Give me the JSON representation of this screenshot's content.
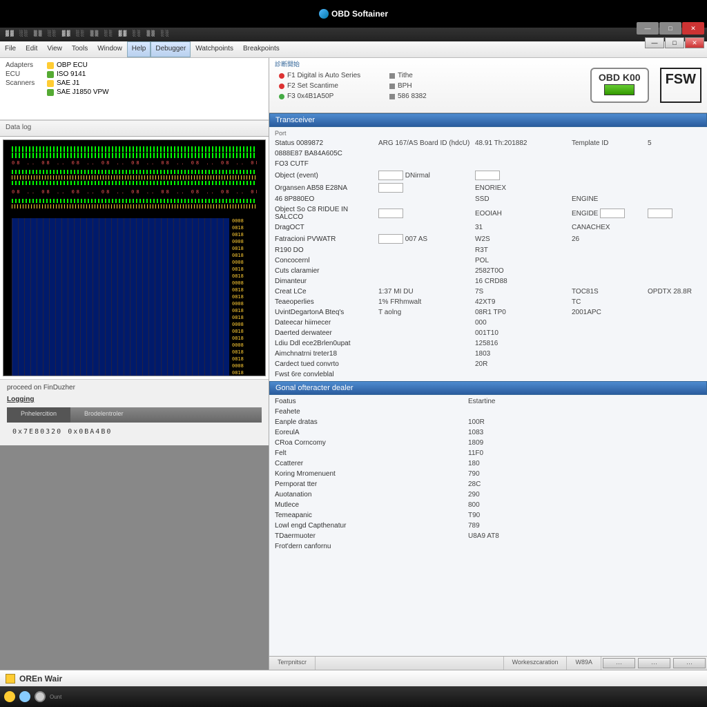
{
  "title": "OBD Softainer",
  "menubar": [
    "File",
    "Edit",
    "View",
    "Tools",
    "Window",
    "Help",
    "Debugger",
    "Watchpoints",
    "Breakpoints"
  ],
  "tree": {
    "left_col": [
      "Adapters",
      "ECU",
      "Scanners"
    ],
    "items": [
      {
        "icon": "yellow",
        "label": "OBP ECU"
      },
      {
        "icon": "green",
        "label": "ISO 9141"
      },
      {
        "icon": "yellow",
        "label": "SAE J1"
      },
      {
        "icon": "green",
        "label": "SAE J1850 VPW"
      }
    ],
    "subtab": "Data log"
  },
  "left_footer": {
    "line1": "proceed on FinDuzher",
    "link": "Logging",
    "crumb": "0x7E80320  0x0BA4B0"
  },
  "band": {
    "tablabel": "診断開始",
    "col1": [
      {
        "icon": "red",
        "label": "F1 Digital is Auto Series"
      },
      {
        "icon": "red",
        "label": "F2 Set Scantime"
      },
      {
        "icon": "grn",
        "label": "F3 0x4B1A50P"
      }
    ],
    "col2": [
      {
        "icon": "gry",
        "label": "Tithe"
      },
      {
        "icon": "gry",
        "label": "BPH"
      },
      {
        "icon": "gry",
        "label": "586 8382"
      }
    ],
    "obd": "OBD K00",
    "logo": "FSW"
  },
  "section1": {
    "title": "Transceiver",
    "sub": "Port",
    "rows": [
      {
        "l": "Status 0089872",
        "v2": "ARG 167/AS Board ID (hdcU)",
        "v3": "48.91 Th:201882",
        "v4": "Template ID",
        "v5": "5"
      },
      {
        "l": "0888E87 BA84A605C",
        "v2": "",
        "v3": "",
        "v4": "",
        "v5": ""
      },
      {
        "l": "FO3 CUTF",
        "v2": "",
        "v3": "",
        "v4": "",
        "v5": ""
      },
      {
        "l": "Object (event)",
        "v2_input": "",
        "v2b": "DNirmal",
        "v3_input": "",
        "v4": "",
        "v5": ""
      },
      {
        "l": "Organsen AB58 E28NA",
        "v2_input": "",
        "v3": "ENORIEX",
        "v4": "",
        "v5": ""
      },
      {
        "l": "46 8P880EO",
        "v2": "",
        "v3": "SSD",
        "v4": "ENGINE",
        "v5": ""
      },
      {
        "l": "Object So C8 RIDUE IN SALCCO",
        "v2_input": "",
        "v3": "EOOIAH",
        "v4": "ENGIDE",
        "v4_input": "",
        "v5_input": ""
      },
      {
        "l": "DragOCT",
        "v2": "",
        "v3": "31",
        "v4": "CANACHEX",
        "v5": ""
      },
      {
        "l": "Fatracioni PVWATR",
        "v2_input": "",
        "v2b": "007 AS",
        "v3": "W2S",
        "v4": "26",
        "v5": ""
      },
      {
        "l": "R190 DO",
        "v2": "",
        "v3": "R3T",
        "v4": "",
        "v5": ""
      },
      {
        "l": "Concocernl",
        "v2": "",
        "v3": "POL",
        "v4": "",
        "v5": ""
      },
      {
        "l": "Cuts claramier",
        "v2": "",
        "v3": "2582T0O",
        "v4": "",
        "v5": ""
      },
      {
        "l": "Dimanteur",
        "v2": "",
        "v3": "16 CRD88",
        "v4": "",
        "v5": ""
      },
      {
        "l": "Creat LCe",
        "v2": "1:37 MI DU",
        "v3": "7S",
        "v4": "TOC81S",
        "v5": "OPDTX 28.8R"
      },
      {
        "l": "Teaeoperlies",
        "v2": "1% FRhmwalt",
        "v3": "42XT9",
        "v4": "TC",
        "v5": ""
      },
      {
        "l": "UvintDegartonA Bteq's",
        "v2": "T aolng",
        "v3": "08R1 TP0",
        "v4": "2001APC",
        "v5": ""
      },
      {
        "l": "Dateecar hiimecer",
        "v2": "",
        "v3": "000",
        "v4": "",
        "v5": ""
      },
      {
        "l": "Daerted derwateer",
        "v2": "",
        "v3": "001T10",
        "v4": "",
        "v5": ""
      },
      {
        "l": "Ldiu Ddl ece2Brlen0upat",
        "v2": "",
        "v3": "125816",
        "v4": "",
        "v5": ""
      },
      {
        "l": "Aimchnatrni treter18",
        "v2": "",
        "v3": "1803",
        "v4": "",
        "v5": ""
      },
      {
        "l": "Cardect tued convrto",
        "v2": "",
        "v3": "20R",
        "v4": "",
        "v5": ""
      },
      {
        "l": "Fwst 6re convleblal",
        "v2": "",
        "v3": "",
        "v4": "",
        "v5": ""
      }
    ]
  },
  "section2": {
    "title": "Gonal ofteracter dealer",
    "rows": [
      {
        "l": "Foatus",
        "v": "Estartine"
      },
      {
        "l": "Feahete",
        "v": ""
      },
      {
        "l": "Eanple dratas",
        "v": "100R"
      },
      {
        "l": "EoreulA",
        "v": "1083"
      },
      {
        "l": "CRoa Corncomy",
        "v": "1809"
      },
      {
        "l": "Felt",
        "v": "11F0"
      },
      {
        "l": "Ccatterer",
        "v": "180"
      },
      {
        "l": "Koring Mromenuent",
        "v": "790"
      },
      {
        "l": "Pernporat tter",
        "v": "28C"
      },
      {
        "l": "Auotanation",
        "v": "290"
      },
      {
        "l": "Mutlece",
        "v": "800"
      },
      {
        "l": "Temeapanic",
        "v": "T90"
      },
      {
        "l": "Lowl engd Capthenatur",
        "v": "789"
      },
      {
        "l": "TDaermuoter",
        "v": "U8A9 AT8"
      },
      {
        "l": "Frot'dern canfornu",
        "v": ""
      }
    ]
  },
  "statusbar": {
    "c1": "Terrpnitscr",
    "c2": "Workeszcaration",
    "c3": "W89A"
  },
  "appbar": "OREn Wair"
}
